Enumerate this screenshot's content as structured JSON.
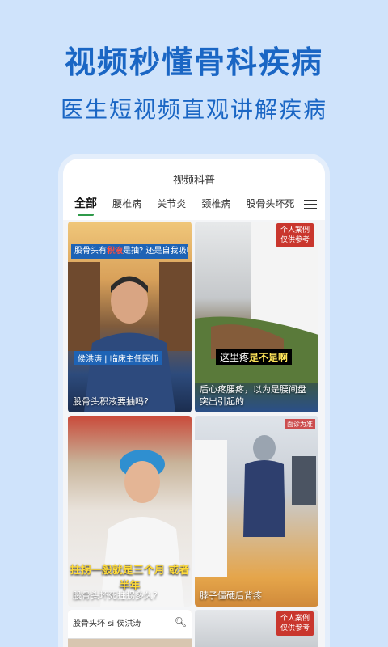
{
  "hero": {
    "title": "视频秒懂骨科疾病",
    "subtitle": "医生短视频直观讲解疾病"
  },
  "app": {
    "title": "视频科普",
    "tabs": [
      "全部",
      "腰椎病",
      "关节炎",
      "颈椎病",
      "股骨头坏死"
    ],
    "active_tab": "全部"
  },
  "cards": [
    {
      "caption": "股骨头积液要抽吗?",
      "overlay_prefix": "股骨头有",
      "overlay_highlight": "积液",
      "overlay_suffix": "是抽? 还是自我吸收",
      "tag": "侯洪涛 | 临床主任医师"
    },
    {
      "caption": "后心疼腰疼，以为是腰间盘突出引起的",
      "badge_line1": "个人案例",
      "badge_line2": "仅供参考",
      "tag_prefix": "这里疼",
      "tag_highlight": "是不是啊"
    },
    {
      "caption": "股骨头坏死拄拐多久?",
      "tag": "拄拐一般就是三个月 或者半年"
    },
    {
      "caption": "脖子僵硬后背疼",
      "badge": "面诊为准"
    },
    {
      "search_text": "股骨头坏 si   侯洪涛"
    },
    {
      "badge_line1": "个人案例",
      "badge_line2": "仅供参考"
    }
  ],
  "colors": {
    "background": "#cfe3fb",
    "hero_text": "#1a66c4",
    "tab_indicator": "#2f9a4a"
  }
}
